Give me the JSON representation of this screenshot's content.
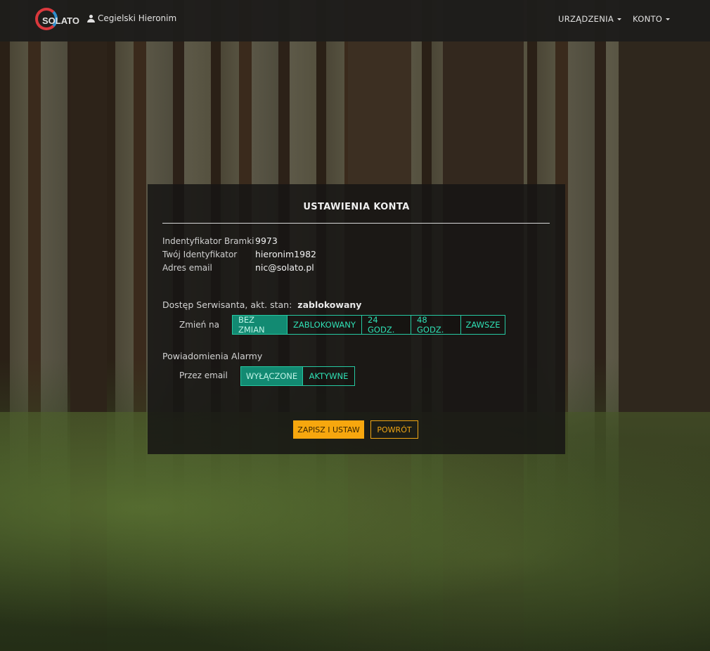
{
  "navbar": {
    "logo_text": "SOLATO",
    "user_name": "Cegielski Hieronim",
    "menu_devices": "URZĄDZENIA",
    "menu_account": "KONTO"
  },
  "panel": {
    "title": "USTAWIENIA KONTA",
    "info": [
      {
        "label": "Indentyfikator Bramki",
        "value": "9973"
      },
      {
        "label": "Twój Identyfikator",
        "value": "hieronim1982"
      },
      {
        "label": "Adres email",
        "value": "nic@solato.pl"
      }
    ],
    "service_access": {
      "label": "Dostęp Serwisanta, akt. stan:",
      "state": "zablokowany",
      "change_label": "Zmień na",
      "options": [
        "BEZ ZMIAN",
        "ZABLOKOWANY",
        "24 GODZ.",
        "48 GODZ.",
        "ZAWSZE"
      ],
      "selected": "BEZ ZMIAN"
    },
    "alarm_notifications": {
      "label": "Powiadomienia Alarmy",
      "email_label": "Przez email",
      "options": [
        "WYŁĄCZONE",
        "AKTYWNE"
      ],
      "selected": "WYŁĄCZONE"
    },
    "save_button": "ZAPISZ I USTAW",
    "back_button": "POWRÓT"
  },
  "colors": {
    "accent_teal": "#26c9a2",
    "accent_orange": "#f7a70e",
    "navbar_bg": "#1e1d1b"
  }
}
